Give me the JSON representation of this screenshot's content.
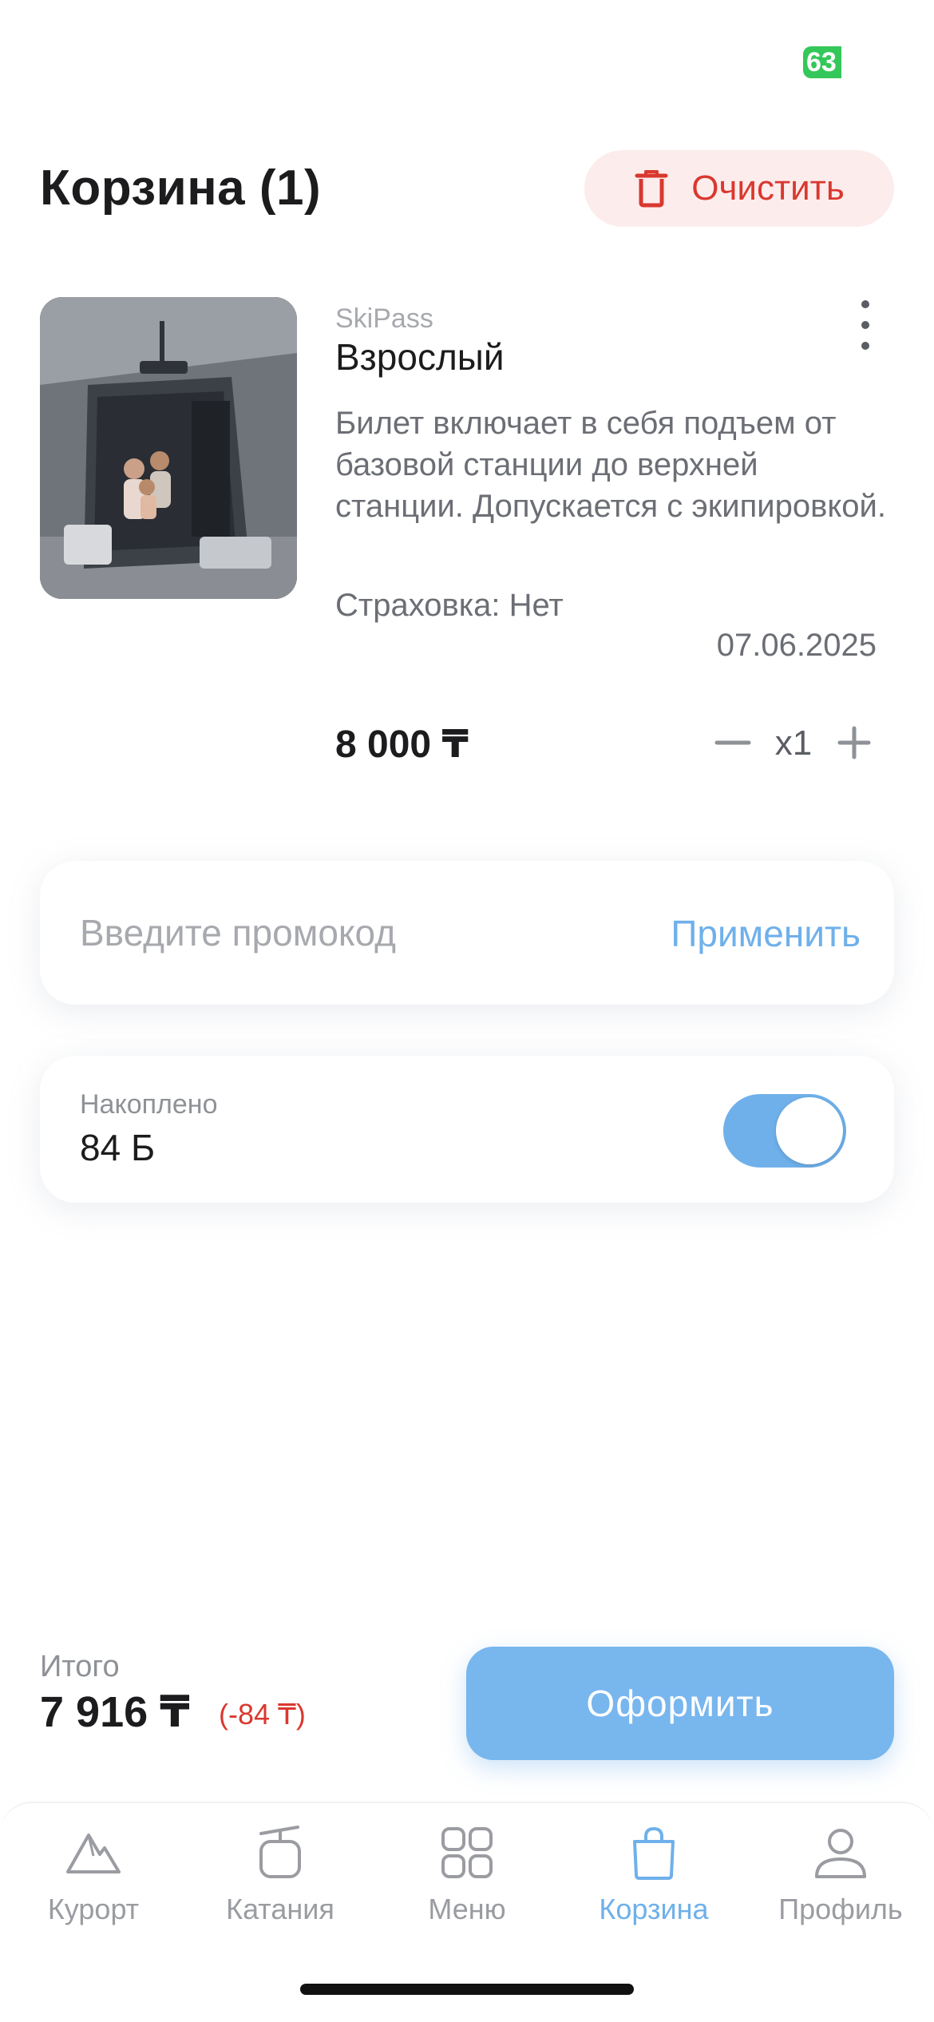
{
  "status_bar": {
    "battery": "63"
  },
  "header": {
    "title": "Корзина (1)",
    "clear_label": "Очистить"
  },
  "cart": {
    "items": [
      {
        "category": "SkiPass",
        "name": "Взрослый",
        "description": "Билет включает в себя подъем от базовой станции до верхней станции. Допускается с экипировкой.",
        "insurance": "Страховка: Нет",
        "date": "07.06.2025",
        "price": "8 000 ₸",
        "quantity": "x1"
      }
    ]
  },
  "promo": {
    "placeholder": "Введите промокод",
    "apply_label": "Применить"
  },
  "bonus": {
    "label": "Накоплено",
    "value": "84 Б",
    "enabled": true
  },
  "summary": {
    "total_label": "Итого",
    "total_value": "7 916 ₸",
    "discount": "(-84 ₸)",
    "checkout_label": "Оформить"
  },
  "tabs": [
    {
      "label": "Курорт",
      "icon": "mountain-icon",
      "active": false
    },
    {
      "label": "Катания",
      "icon": "cable-car-icon",
      "active": false
    },
    {
      "label": "Меню",
      "icon": "grid-icon",
      "active": false
    },
    {
      "label": "Корзина",
      "icon": "shopping-bag-icon",
      "active": true
    },
    {
      "label": "Профиль",
      "icon": "user-icon",
      "active": false
    }
  ],
  "colors": {
    "accent": "#6fb0ea",
    "danger": "#d9382f",
    "danger_bg": "#fdecec",
    "battery": "#34c759"
  }
}
